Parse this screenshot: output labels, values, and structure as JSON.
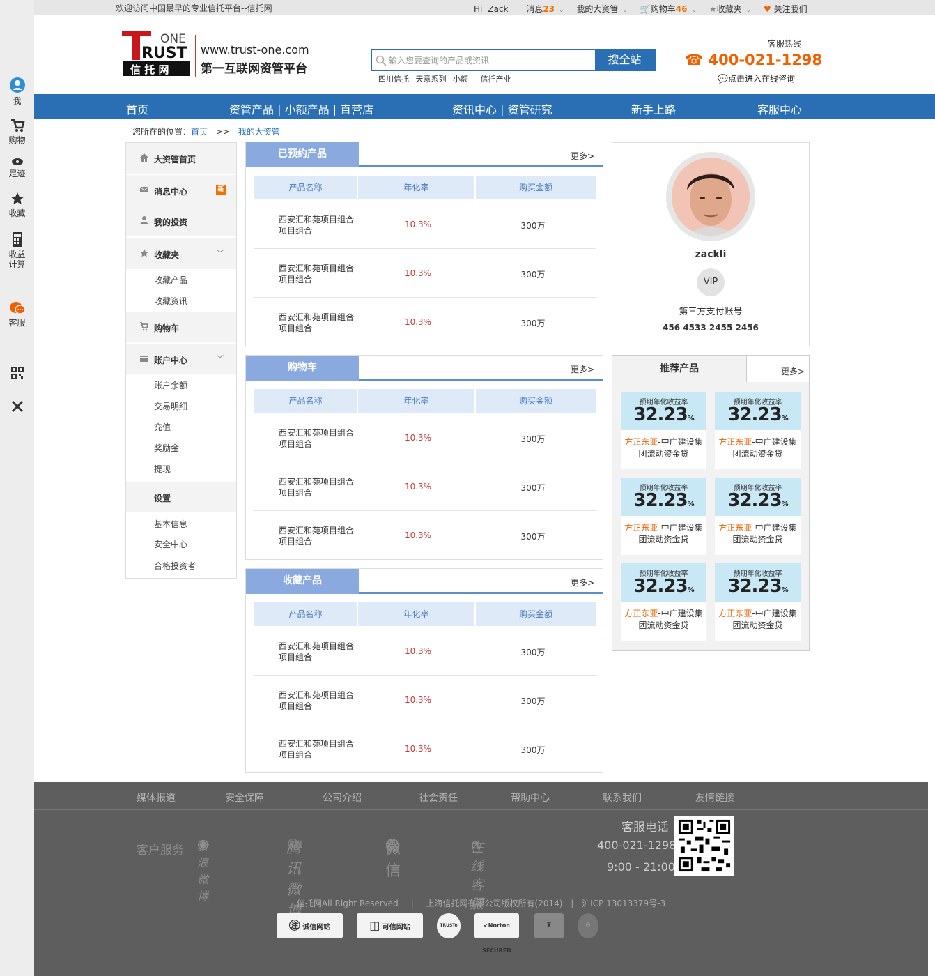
{
  "sidebar_left": {
    "items": [
      {
        "label": "我",
        "icon": "user-icon"
      },
      {
        "label": "购物",
        "icon": "cart-icon"
      },
      {
        "label": "足迹",
        "icon": "eye-icon"
      },
      {
        "label": "收藏",
        "icon": "star-icon"
      },
      {
        "label": "收益计算",
        "icon": "calculator-icon"
      },
      {
        "label": "客服",
        "icon": "chat-icon"
      }
    ],
    "qr_icon": "qr-code-icon",
    "close_icon": "close-icon"
  },
  "topbar": {
    "welcome": "欢迎访问中国最早的专业信托平台--信托网",
    "hi": "Hi",
    "user": "Zack",
    "messages_label": "消息",
    "messages_count": "23",
    "my_account": "我的大资管",
    "cart_label": "购物车",
    "cart_count": "46",
    "favorites": "收藏夹",
    "follow": "关注我们"
  },
  "header": {
    "logo_one": "ONE",
    "logo_trust": "RUST",
    "logo_cn": "信 托 网",
    "site_url": "www.trust-one.com",
    "slogan": "第一互联网资管平台",
    "search_placeholder": "输入您要查询的产品或资讯",
    "search_button": "搜全站",
    "hot_words": [
      "四川信托",
      "天意系列",
      "小额",
      "信托产业"
    ],
    "hotline_label": "客服热线",
    "phone": "400-021-1298",
    "online_consult": "点击进入在线咨询"
  },
  "nav": {
    "items": [
      "首页",
      "资管产品 | 小额产品 | 直营店",
      "资讯中心 | 资管研究",
      "新手上路",
      "客服中心"
    ]
  },
  "breadcrumb": {
    "label": "您所在的位置：",
    "home": "首页",
    "sep": ">>",
    "current": "我的大资管"
  },
  "side_menu": {
    "home": "大资管首页",
    "messages": "消息中心",
    "new_badge": "新",
    "investments": "我的投资",
    "favorites": "收藏夹",
    "fav_items": [
      "收藏产品",
      "收藏资讯"
    ],
    "cart": "购物车",
    "account": "账户中心",
    "account_items": [
      "账户余额",
      "交易明细",
      "充值",
      "奖励金",
      "提现"
    ],
    "settings": "设置",
    "settings_items": [
      "基本信息",
      "安全中心",
      "合格投资者"
    ]
  },
  "panels": [
    {
      "title": "已预约产品",
      "more": "更多>",
      "columns": [
        "产品名称",
        "年化率",
        "购买金额"
      ],
      "rows": [
        {
          "name": "西安汇和苑项目组合项目组合",
          "rate": "10.3%",
          "amount": "300万"
        },
        {
          "name": "西安汇和苑项目组合项目组合",
          "rate": "10.3%",
          "amount": "300万"
        },
        {
          "name": "西安汇和苑项目组合项目组合",
          "rate": "10.3%",
          "amount": "300万"
        }
      ]
    },
    {
      "title": "购物车",
      "more": "更多>",
      "columns": [
        "产品名称",
        "年化率",
        "购买金额"
      ],
      "rows": [
        {
          "name": "西安汇和苑项目组合项目组合",
          "rate": "10.3%",
          "amount": "300万"
        },
        {
          "name": "西安汇和苑项目组合项目组合",
          "rate": "10.3%",
          "amount": "300万"
        },
        {
          "name": "西安汇和苑项目组合项目组合",
          "rate": "10.3%",
          "amount": "300万"
        }
      ]
    },
    {
      "title": "收藏产品",
      "more": "更多>",
      "columns": [
        "产品名称",
        "年化率",
        "购买金额"
      ],
      "rows": [
        {
          "name": "西安汇和苑项目组合项目组合",
          "rate": "10.3%",
          "amount": "300万"
        },
        {
          "name": "西安汇和苑项目组合项目组合",
          "rate": "10.3%",
          "amount": "300万"
        },
        {
          "name": "西安汇和苑项目组合项目组合",
          "rate": "10.3%",
          "amount": "300万"
        }
      ]
    }
  ],
  "profile": {
    "username": "zackli",
    "vip": "VIP",
    "account_label": "第三方支付账号",
    "account_number": "456 4533 2455 2456"
  },
  "recommend": {
    "title": "推荐产品",
    "more": "更多>",
    "cards": [
      {
        "label": "预期年化收益率",
        "value": "32.23",
        "unit": "%",
        "issuer": "方正东亚",
        "product": "-中广建设集团流动资金贷"
      },
      {
        "label": "预期年化收益率",
        "value": "32.23",
        "unit": "%",
        "issuer": "方正东亚",
        "product": "-中广建设集团流动资金贷"
      },
      {
        "label": "预期年化收益率",
        "value": "32.23",
        "unit": "%",
        "issuer": "方正东亚",
        "product": "-中广建设集团流动资金贷"
      },
      {
        "label": "预期年化收益率",
        "value": "32.23",
        "unit": "%",
        "issuer": "方正东亚",
        "product": "-中广建设集团流动资金贷"
      },
      {
        "label": "预期年化收益率",
        "value": "32.23",
        "unit": "%",
        "issuer": "方正东亚",
        "product": "-中广建设集团流动资金贷"
      },
      {
        "label": "预期年化收益率",
        "value": "32.23",
        "unit": "%",
        "issuer": "方正东亚",
        "product": "-中广建设集团流动资金贷"
      }
    ]
  },
  "footer": {
    "links": [
      "媒体报道",
      "安全保障",
      "公司介绍",
      "社会责任",
      "帮助中心",
      "联系我们",
      "友情链接"
    ],
    "service_label": "客户服务",
    "services": [
      {
        "label": "新浪微博",
        "icon": "weibo-icon"
      },
      {
        "label": "腾讯微博",
        "icon": "tencent-weibo-icon"
      },
      {
        "label": "微信",
        "icon": "wechat-icon"
      },
      {
        "label": "在线客服",
        "icon": "headset-icon"
      }
    ],
    "kf_label": "客服电话",
    "kf_phone": "400-021-1298",
    "kf_hours": "9:00 - 21:00",
    "copyright": "信托网All Right Reserved",
    "company": "上海信托网有限公司版权所有(2014)",
    "icp": "沪ICP 13013379号-3",
    "badges": [
      "诚信网站",
      "可信网站",
      "TRUSTe",
      "Norton SECURED",
      "",
      ""
    ]
  }
}
